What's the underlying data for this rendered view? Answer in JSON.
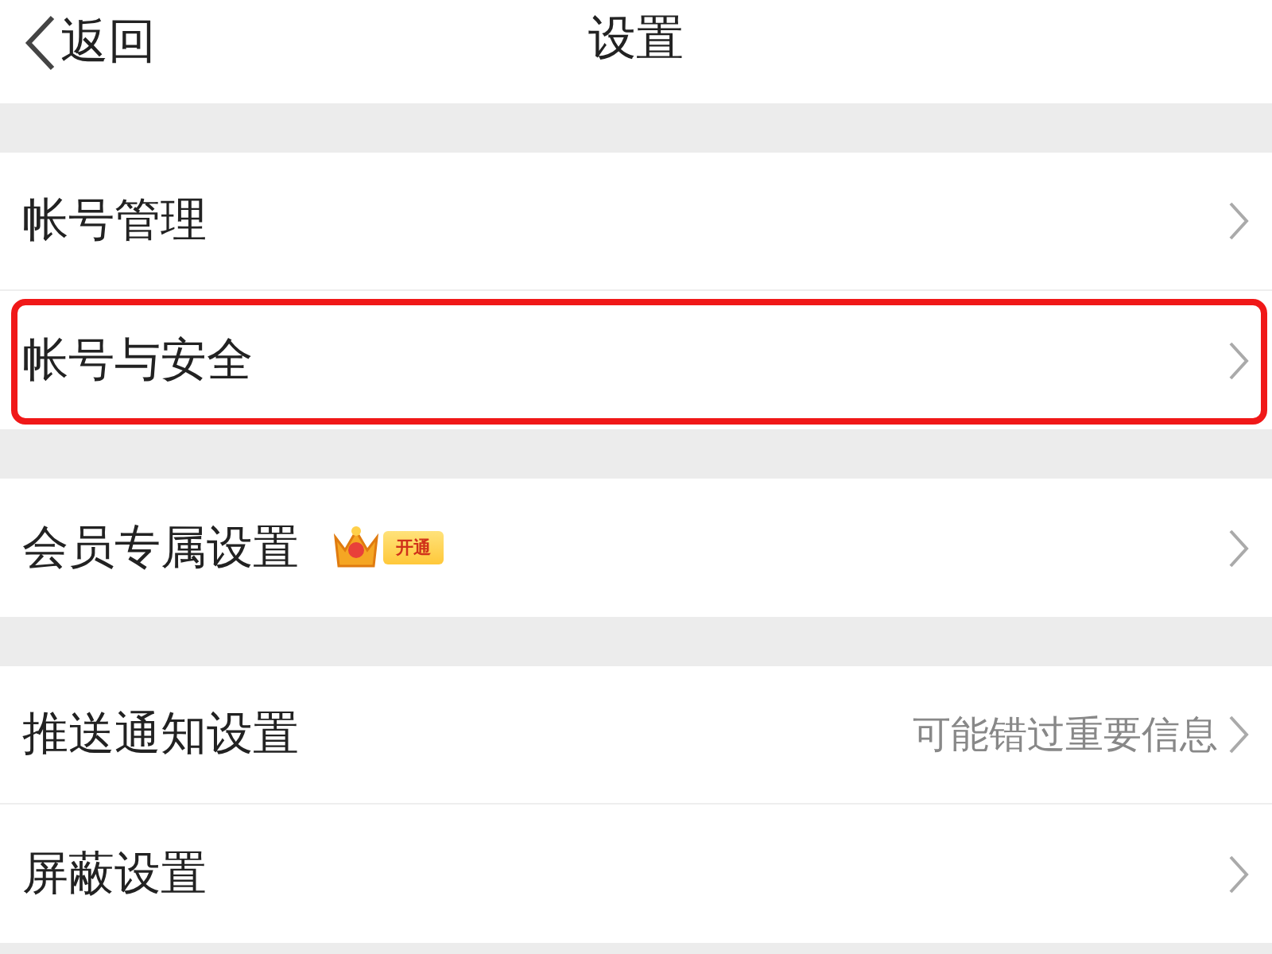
{
  "header": {
    "back_label": "返回",
    "title": "设置"
  },
  "groups": [
    {
      "items": [
        {
          "label": "帐号管理",
          "highlighted": false
        },
        {
          "label": "帐号与安全",
          "highlighted": true
        }
      ]
    },
    {
      "items": [
        {
          "label": "会员专属设置",
          "highlighted": false,
          "badge": "开通"
        }
      ]
    },
    {
      "items": [
        {
          "label": "推送通知设置",
          "highlighted": false,
          "hint": "可能错过重要信息"
        },
        {
          "label": "屏蔽设置",
          "highlighted": false
        }
      ]
    }
  ]
}
